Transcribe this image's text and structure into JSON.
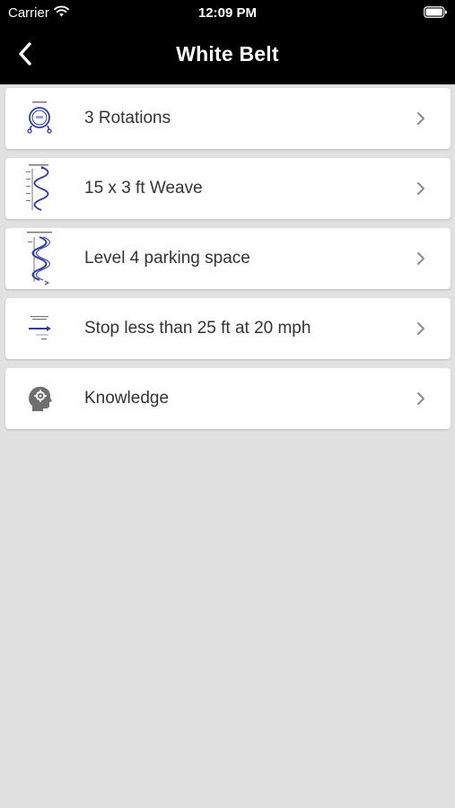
{
  "status_bar": {
    "carrier": "Carrier",
    "time": "12:09 PM"
  },
  "nav": {
    "title": "White Belt",
    "back_icon": "chevron-left-icon"
  },
  "items": [
    {
      "label": "3 Rotations",
      "icon": "rotations-diagram-icon"
    },
    {
      "label": "15 x 3 ft Weave",
      "icon": "weave-diagram-icon"
    },
    {
      "label": "Level 4 parking space",
      "icon": "parking-space-diagram-icon"
    },
    {
      "label": "Stop less than 25 ft at 20 mph",
      "icon": "stop-distance-diagram-icon"
    },
    {
      "label": "Knowledge",
      "icon": "head-gear-icon"
    }
  ],
  "colors": {
    "bar_background": "#000000",
    "page_background": "#e1e1e1",
    "card_background": "#ffffff",
    "diagram_blue": "#2d3aa8",
    "chevron": "#8a8a8a",
    "knowledge_icon": "#6e6e6e"
  }
}
